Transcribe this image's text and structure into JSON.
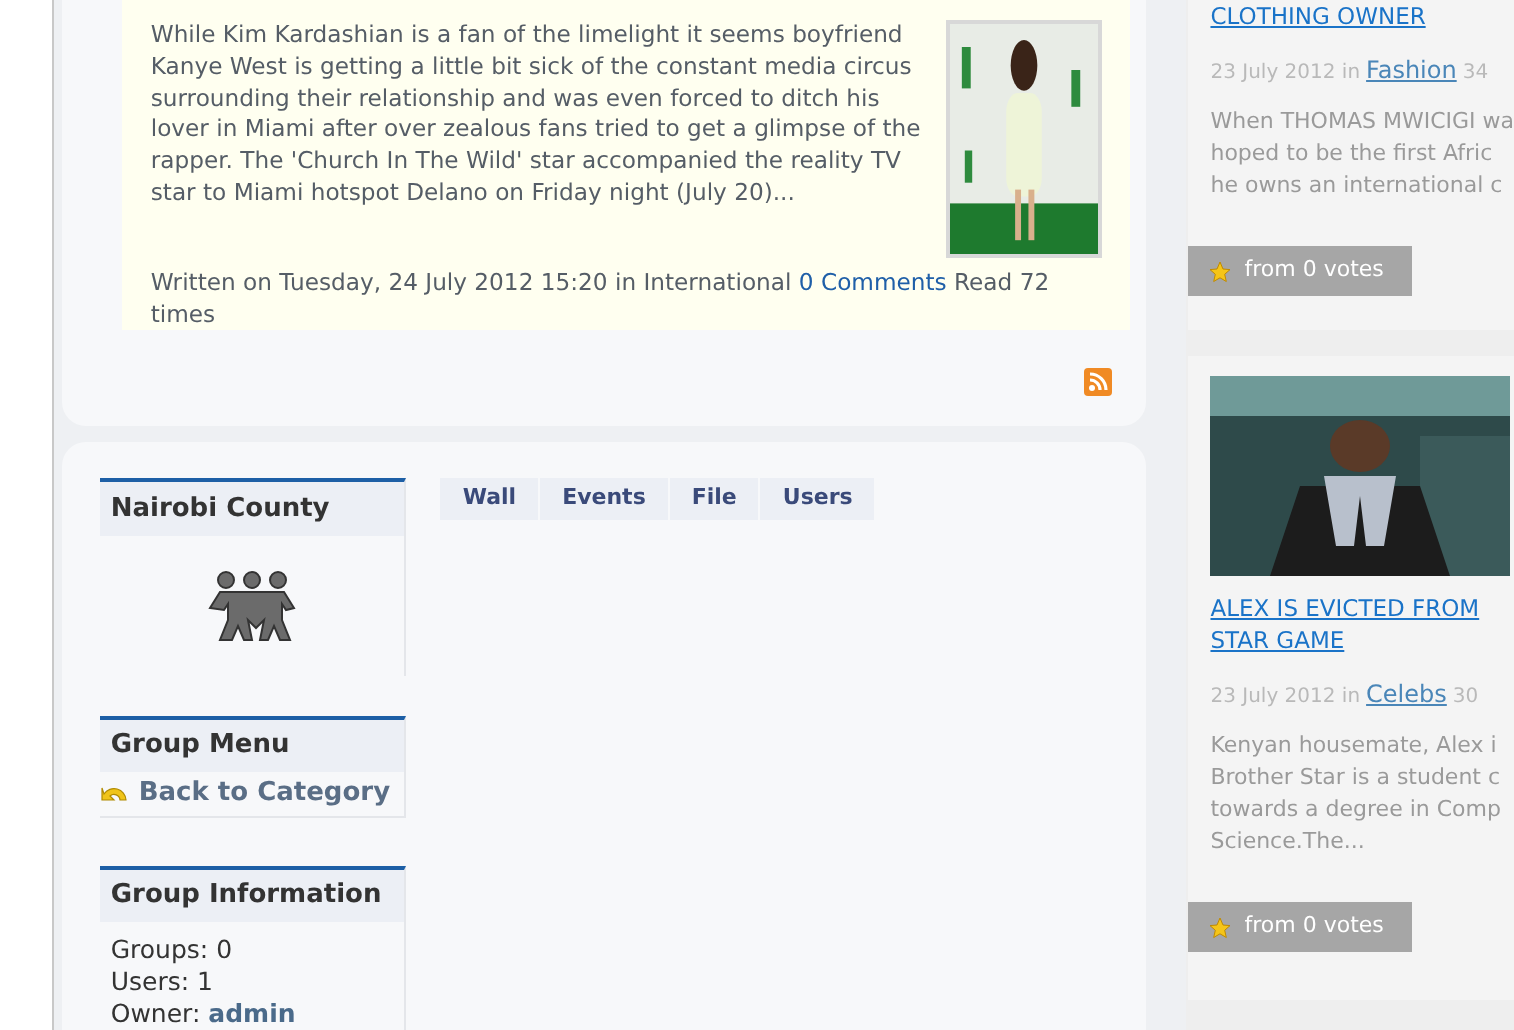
{
  "article": {
    "summary": "While Kim Kardashian is a fan of the limelight it seems boyfriend Kanye West is getting a little bit sick of the constant media circus surrounding their relationship and was even forced to ditch his lover in Miami after over zealous fans tried to get a glimpse of the rapper. The 'Church In The Wild' star accompanied the reality TV star to Miami hotspot Delano on Friday night (July 20)...",
    "written": "Written on Tuesday, 24 July 2012 15:20 in International",
    "comments": "0 Comments",
    "reads": "Read 72 times",
    "image": {
      "kind": "picture"
    }
  },
  "group": {
    "name": "Nairobi County",
    "menu_title": "Group Menu",
    "back_link": "Back to Category",
    "info_title": "Group Information",
    "info": [
      "Groups: 0",
      "Users: 1"
    ],
    "owner_label": "Owner:",
    "owner": "admin"
  },
  "tabs": [
    {
      "label": "Wall"
    },
    {
      "label": "Events"
    },
    {
      "label": "File"
    },
    {
      "label": "Users"
    }
  ],
  "side_cards": [
    {
      "title": [
        "CLOTHING OWNER"
      ],
      "date": "23 July 2012 in",
      "category": "Fashion",
      "hits": "34",
      "excerpt": [
        "When THOMAS MWICIGI wa",
        "hoped to be the first Afric",
        "he owns an international c"
      ],
      "votes": "from 0 votes"
    },
    {
      "title": [
        "ALEX IS EVICTED FROM",
        "STAR GAME"
      ],
      "date": "23 July 2012 in",
      "category": "Celebs",
      "hits": "30",
      "excerpt": [
        "Kenyan housemate, Alex i",
        "Brother Star is a student c",
        "towards a degree in Comp",
        "Science.The..."
      ],
      "votes": "from 0 votes",
      "image": {
        "kind": "picture"
      }
    }
  ]
}
